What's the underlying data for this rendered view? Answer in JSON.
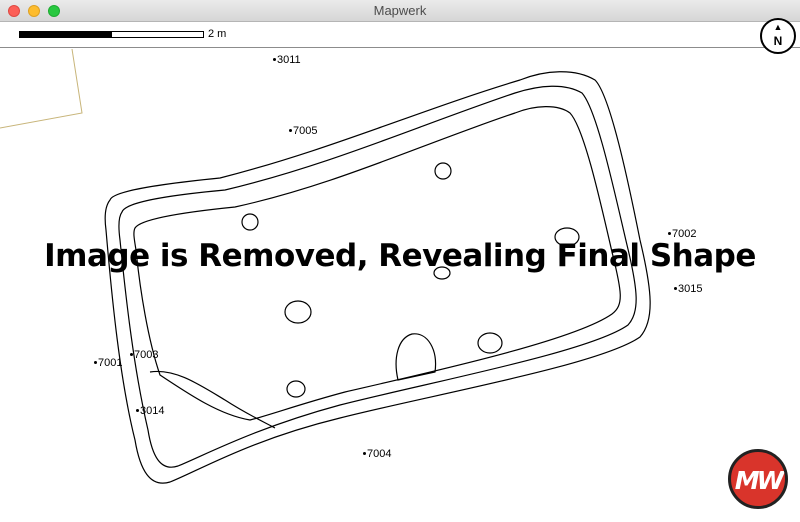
{
  "window": {
    "title": "Mapwerk"
  },
  "toolbar": {
    "scale_label": "2 m",
    "north_letter": "N",
    "north_arrow_glyph": "▲"
  },
  "overlay": {
    "caption": "Image is Removed, Revealing Final Shape"
  },
  "points": [
    {
      "id": "3011",
      "label": "3011"
    },
    {
      "id": "7005",
      "label": "7005"
    },
    {
      "id": "7002",
      "label": "7002"
    },
    {
      "id": "3015",
      "label": "3015"
    },
    {
      "id": "7003",
      "label": "7003"
    },
    {
      "id": "7001",
      "label": "7001"
    },
    {
      "id": "3014",
      "label": "3014"
    },
    {
      "id": "7004",
      "label": "7004"
    }
  ],
  "logo": {
    "text": "MW"
  },
  "colors": {
    "close": "#fc5f57",
    "minimize": "#fdbc2e",
    "maximize": "#28c840",
    "boundary_line": "#c8b57a",
    "logo_bg": "#d9342b"
  },
  "icons": [
    "close-icon",
    "minimize-icon",
    "maximize-icon",
    "north-arrow-icon"
  ]
}
